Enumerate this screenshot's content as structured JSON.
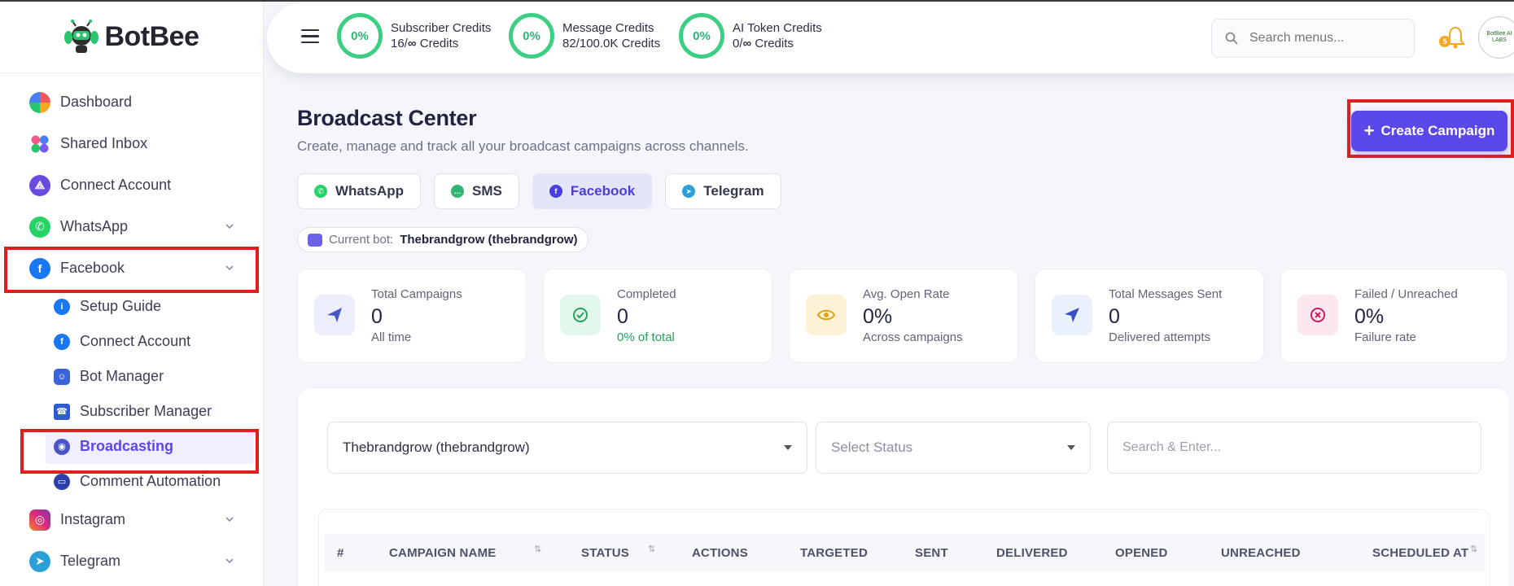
{
  "brand": {
    "name": "BotBee"
  },
  "sidebar": {
    "items": [
      {
        "label": "Dashboard",
        "icon": "dashboard-icon"
      },
      {
        "label": "Shared Inbox",
        "icon": "shared-inbox-icon"
      },
      {
        "label": "Connect Account",
        "icon": "connect-account-icon"
      },
      {
        "label": "WhatsApp",
        "icon": "whatsapp-icon"
      },
      {
        "label": "Facebook",
        "icon": "facebook-icon"
      },
      {
        "label": "Instagram",
        "icon": "instagram-icon"
      },
      {
        "label": "Telegram",
        "icon": "telegram-icon"
      }
    ],
    "facebook_sub": [
      {
        "label": "Setup Guide",
        "icon": "info-icon"
      },
      {
        "label": "Connect Account",
        "icon": "facebook-icon"
      },
      {
        "label": "Bot Manager",
        "icon": "robot-icon"
      },
      {
        "label": "Subscriber Manager",
        "icon": "subscriber-icon"
      },
      {
        "label": "Broadcasting",
        "icon": "broadcast-icon"
      },
      {
        "label": "Comment Automation",
        "icon": "comment-icon"
      }
    ]
  },
  "topbar": {
    "credits": [
      {
        "percent": "0%",
        "title": "Subscriber Credits",
        "value_prefix": "16/",
        "value_suffix": "Credits"
      },
      {
        "percent": "0%",
        "title": "Message Credits",
        "value_prefix": "82/100.0K",
        "value_suffix": "Credits"
      },
      {
        "percent": "0%",
        "title": "AI Token Credits",
        "value_prefix": "0/",
        "value_suffix": "Credits"
      }
    ],
    "search_placeholder": "Search menus...",
    "bell_badge": "5",
    "avatar_text": "BotBee AI LABS"
  },
  "header": {
    "title": "Broadcast Center",
    "subtitle": "Create, manage and track all your broadcast campaigns across channels.",
    "create_label": "Create Campaign"
  },
  "channels": [
    {
      "label": "WhatsApp",
      "color": "#25d366"
    },
    {
      "label": "SMS",
      "color": "#2fb673"
    },
    {
      "label": "Facebook",
      "color": "#4a3fd8"
    },
    {
      "label": "Telegram",
      "color": "#2a9fd8"
    }
  ],
  "current_bot": {
    "label": "Current bot:",
    "value": "Thebrandgrow (thebrandgrow)"
  },
  "stats": [
    {
      "title": "Total Campaigns",
      "value": "0",
      "sub": "All time",
      "icon": "send-icon"
    },
    {
      "title": "Completed",
      "value": "0",
      "sub": "0% of total",
      "icon": "check-circle-icon"
    },
    {
      "title": "Avg. Open Rate",
      "value": "0%",
      "sub": "Across campaigns",
      "icon": "eye-icon"
    },
    {
      "title": "Total Messages Sent",
      "value": "0",
      "sub": "Delivered attempts",
      "icon": "navigation-icon"
    },
    {
      "title": "Failed / Unreached",
      "value": "0%",
      "sub": "Failure rate",
      "icon": "x-circle-icon"
    }
  ],
  "filters": {
    "bot_select": "Thebrandgrow (thebrandgrow)",
    "status_select": "Select Status",
    "search_placeholder": "Search & Enter..."
  },
  "table": {
    "columns": [
      "#",
      "CAMPAIGN NAME",
      "STATUS",
      "ACTIONS",
      "TARGETED",
      "SENT",
      "DELIVERED",
      "OPENED",
      "UNREACHED",
      "SCHEDULED AT"
    ]
  }
}
